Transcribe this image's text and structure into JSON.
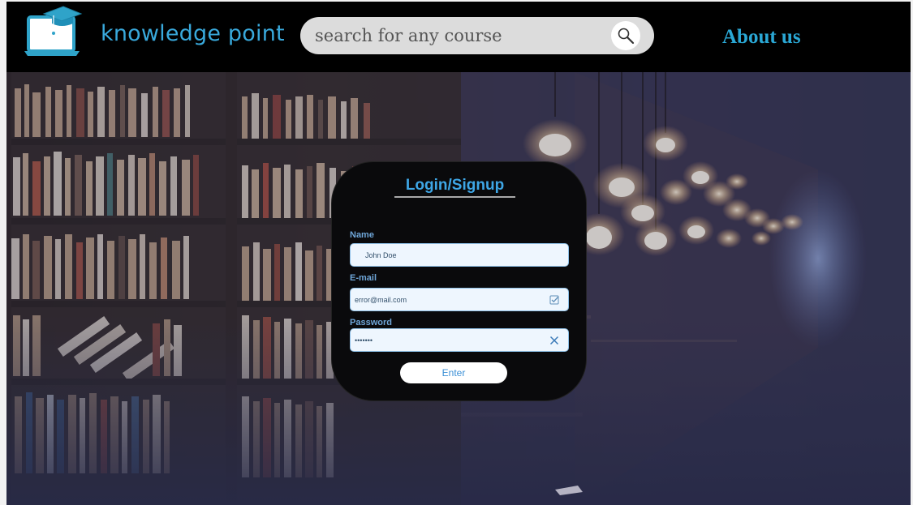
{
  "header": {
    "brand": "knowledge point",
    "search_placeholder": "search for any course",
    "about_label": "About us"
  },
  "icons": {
    "logo": "laptop-graduation-cap-icon",
    "search": "magnifier-icon",
    "email_status": "checkbox-icon",
    "password_status": "close-icon"
  },
  "login": {
    "title": "Login/Signup",
    "name_label": "Name",
    "name_value": "John Doe",
    "email_label": "E-mail",
    "email_value": "error@mail.com",
    "password_label": "Password",
    "password_value": "•••••••",
    "enter_label": "Enter"
  },
  "colors": {
    "header_bg": "#000000",
    "brand": "#39a9dc",
    "about": "#2aa7d4",
    "card_bg": "#0a0a0c",
    "card_title": "#3ea6e6",
    "field_bg": "#eef6fe"
  }
}
